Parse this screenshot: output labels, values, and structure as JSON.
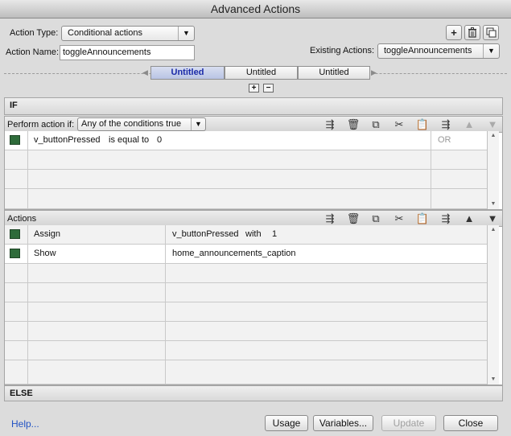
{
  "window": {
    "title": "Advanced Actions"
  },
  "form": {
    "action_type_label": "Action Type:",
    "action_type_value": "Conditional actions",
    "action_name_label": "Action Name:",
    "action_name_value": "toggleAnnouncements",
    "existing_actions_label": "Existing Actions:",
    "existing_actions_value": "toggleAnnouncements"
  },
  "tabs": [
    {
      "label": "Untitled",
      "active": true
    },
    {
      "label": "Untitled",
      "active": false
    },
    {
      "label": "Untitled",
      "active": false
    }
  ],
  "if_section": {
    "header": "IF",
    "perform_label": "Perform action if:",
    "perform_value": "Any of the conditions true",
    "conditions": [
      {
        "variable": "v_buttonPressed",
        "operator": "is equal to",
        "value": "0",
        "logic": "OR"
      }
    ]
  },
  "actions_section": {
    "header": "Actions",
    "rows": [
      {
        "action": "Assign",
        "target": "v_buttonPressed",
        "with_label": "with",
        "value": "1"
      },
      {
        "action": "Show",
        "target": "home_announcements_caption"
      }
    ]
  },
  "else_section": {
    "header": "ELSE"
  },
  "footer": {
    "help": "Help...",
    "usage": "Usage",
    "variables": "Variables...",
    "update": "Update",
    "close": "Close"
  },
  "icons": {
    "add": "+",
    "plus": "+",
    "minus": "−"
  },
  "colors": {
    "accent_tab": "#1a2aa8",
    "row_swatch": "#2e6b3a",
    "link": "#2253c4"
  }
}
